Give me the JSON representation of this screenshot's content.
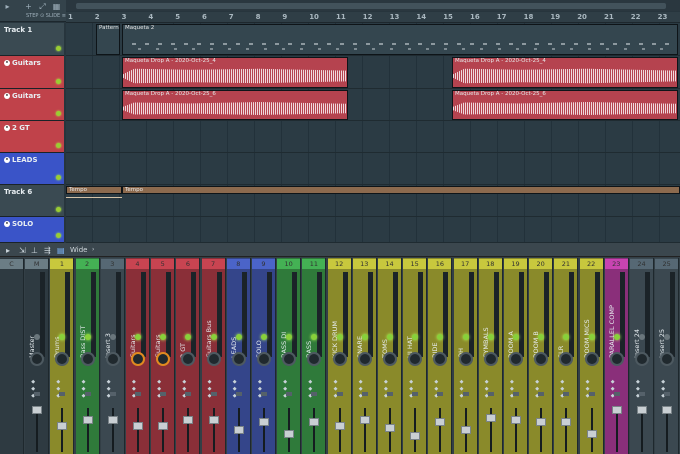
{
  "toolbar": {
    "snap": "STEP ⊙ SLIDE ≡"
  },
  "ruler": {
    "bars": [
      "1",
      "2",
      "3",
      "4",
      "5",
      "6",
      "7",
      "8",
      "9",
      "10",
      "11",
      "12",
      "13",
      "14",
      "15",
      "16",
      "17",
      "18",
      "19",
      "20",
      "21",
      "22",
      "23"
    ]
  },
  "tracks": [
    {
      "label": "Track 1",
      "color": "#3a4a52",
      "numbered": false
    },
    {
      "label": "Guitars",
      "color": "#c0424a",
      "numbered": true
    },
    {
      "label": "Guitars",
      "color": "#c0424a",
      "numbered": true
    },
    {
      "label": "2 GT",
      "color": "#c0424a",
      "numbered": true
    },
    {
      "label": "LEADS",
      "color": "#3a54c8",
      "numbered": true
    },
    {
      "label": "Track 6",
      "color": "#3a4a52",
      "numbered": false
    },
    {
      "label": "SOLO",
      "color": "#3a54c8",
      "numbered": true
    }
  ],
  "clips": {
    "pattern1": "Pattern",
    "pattern2": "Maqueta 2",
    "guitar1a": "Maqueta Drop A - 2020-Oct-25_4",
    "guitar1b": "Maqueta Drop A - 2020-Oct-25_4",
    "guitar2a": "Maqueta Drop A - 2020-Oct-25_6",
    "guitar2b": "Maqueta Drop A - 2020-Oct-25_6",
    "tempo1": "Tempo",
    "tempo2": "Tempo"
  },
  "mixer": {
    "preset": "Wide",
    "strips": [
      {
        "num": "C",
        "name": "",
        "color": "#3b4850"
      },
      {
        "num": "M",
        "name": "Master",
        "color": "#3b4850"
      },
      {
        "num": "1",
        "name": "Drums",
        "color": "#8a8a2a"
      },
      {
        "num": "2",
        "name": "Bass DIST",
        "color": "#2f7a3a"
      },
      {
        "num": "3",
        "name": "Insert 3",
        "color": "#3b4850"
      },
      {
        "num": "4",
        "name": "Guitars",
        "color": "#8a2f38"
      },
      {
        "num": "5",
        "name": "Guitars",
        "color": "#8a2f38"
      },
      {
        "num": "6",
        "name": "2 GT",
        "color": "#8a2f38"
      },
      {
        "num": "7",
        "name": "Guitars Bus",
        "color": "#8a2f38"
      },
      {
        "num": "8",
        "name": "LEADS",
        "color": "#34458a"
      },
      {
        "num": "9",
        "name": "SOLO",
        "color": "#34458a"
      },
      {
        "num": "10",
        "name": "BASS DI",
        "color": "#2f7a3a"
      },
      {
        "num": "11",
        "name": "BASS",
        "color": "#2f7a3a"
      },
      {
        "num": "12",
        "name": "KICK DRUM",
        "color": "#8a8a2a"
      },
      {
        "num": "13",
        "name": "SNARE",
        "color": "#8a8a2a"
      },
      {
        "num": "14",
        "name": "TOMS",
        "color": "#8a8a2a"
      },
      {
        "num": "15",
        "name": "HI HAT",
        "color": "#8a8a2a"
      },
      {
        "num": "16",
        "name": "RIDE",
        "color": "#8a8a2a"
      },
      {
        "num": "17",
        "name": "OH",
        "color": "#8a8a2a"
      },
      {
        "num": "18",
        "name": "CYMBALS",
        "color": "#8a8a2a"
      },
      {
        "num": "19",
        "name": "ROOM A",
        "color": "#8a8a2a"
      },
      {
        "num": "20",
        "name": "ROOM B",
        "color": "#8a8a2a"
      },
      {
        "num": "21",
        "name": "SLR",
        "color": "#8a8a2a"
      },
      {
        "num": "22",
        "name": "ROOM MICS",
        "color": "#8a8a2a"
      },
      {
        "num": "23",
        "name": "PARALLEL COMP",
        "color": "#8a2f7a"
      },
      {
        "num": "24",
        "name": "Insert 24",
        "color": "#3b4850"
      },
      {
        "num": "25",
        "name": "Insert 25",
        "color": "#3b4850"
      }
    ]
  }
}
